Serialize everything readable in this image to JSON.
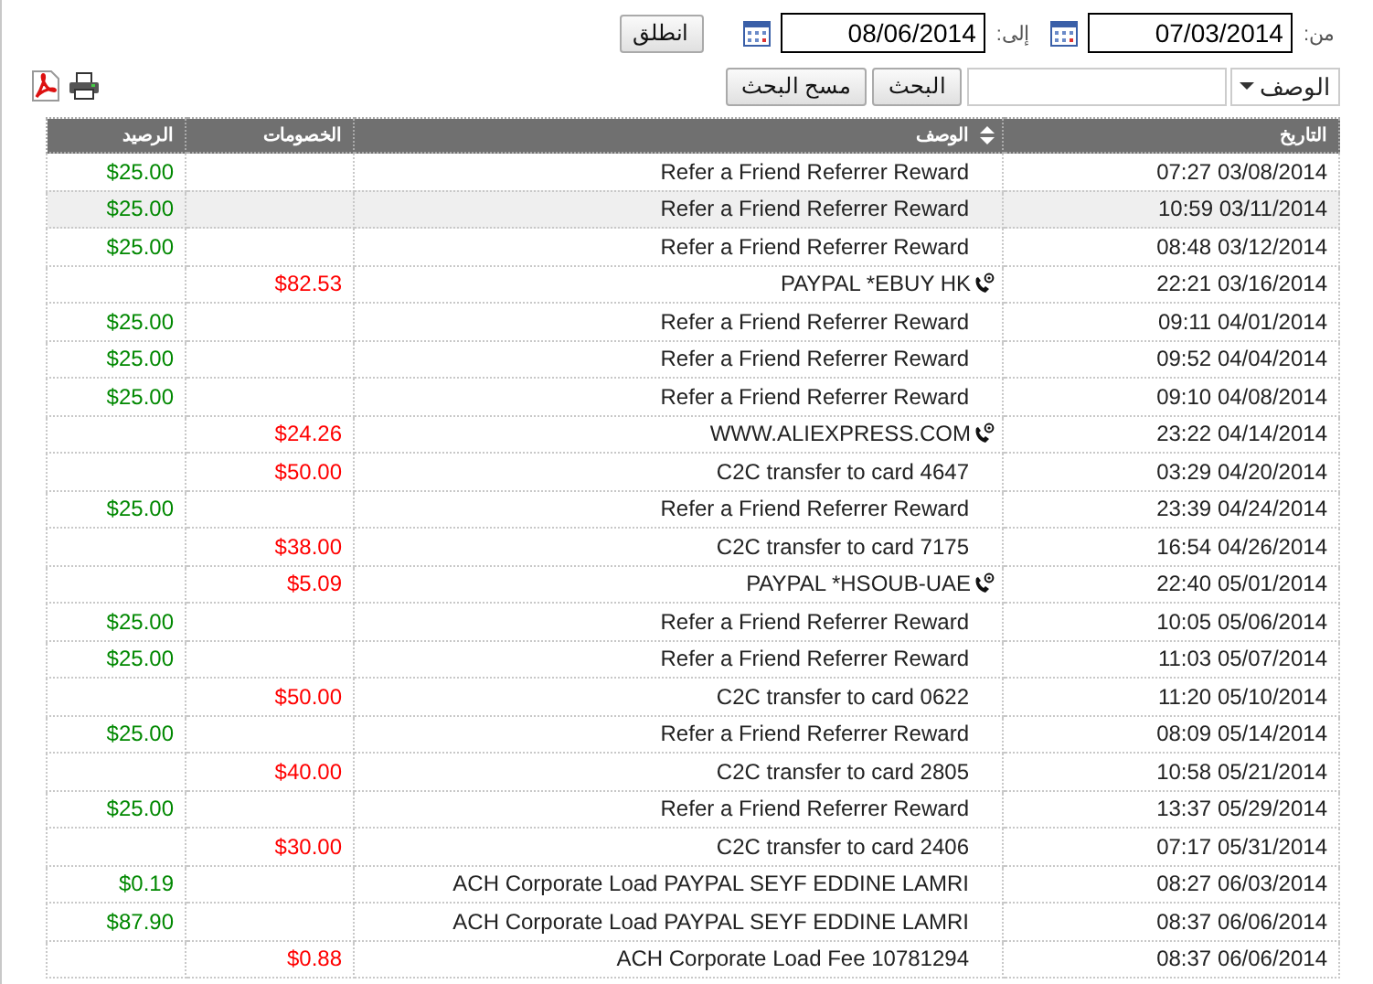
{
  "filters": {
    "from_label": "من:",
    "from_date": "07/03/2014",
    "to_label": "إلى:",
    "to_date": "08/06/2014",
    "go_button": "انطلق"
  },
  "search": {
    "field_select": "الوصف",
    "search_button": "البحث",
    "clear_button": "مسح البحث"
  },
  "table": {
    "columns": [
      "التاريخ",
      "الوصف",
      "الخصومات",
      "الرصيد"
    ],
    "rows": [
      {
        "date": "07:27 03/08/2014",
        "description": "Refer a Friend Referrer Reward",
        "deduction": "",
        "balance": "$25.00",
        "phone_order": false,
        "highlighted": false
      },
      {
        "date": "10:59 03/11/2014",
        "description": "Refer a Friend Referrer Reward",
        "deduction": "",
        "balance": "$25.00",
        "phone_order": false,
        "highlighted": true
      },
      {
        "date": "08:48 03/12/2014",
        "description": "Refer a Friend Referrer Reward",
        "deduction": "",
        "balance": "$25.00",
        "phone_order": false,
        "highlighted": false
      },
      {
        "date": "22:21 03/16/2014",
        "description": "PAYPAL *EBUY HK",
        "deduction": "$82.53",
        "balance": "",
        "phone_order": true,
        "highlighted": false
      },
      {
        "date": "09:11 04/01/2014",
        "description": "Refer a Friend Referrer Reward",
        "deduction": "",
        "balance": "$25.00",
        "phone_order": false,
        "highlighted": false
      },
      {
        "date": "09:52 04/04/2014",
        "description": "Refer a Friend Referrer Reward",
        "deduction": "",
        "balance": "$25.00",
        "phone_order": false,
        "highlighted": false
      },
      {
        "date": "09:10 04/08/2014",
        "description": "Refer a Friend Referrer Reward",
        "deduction": "",
        "balance": "$25.00",
        "phone_order": false,
        "highlighted": false
      },
      {
        "date": "23:22 04/14/2014",
        "description": "WWW.ALIEXPRESS.COM",
        "deduction": "$24.26",
        "balance": "",
        "phone_order": true,
        "highlighted": false
      },
      {
        "date": "03:29 04/20/2014",
        "description": "C2C transfer to card 4647",
        "deduction": "$50.00",
        "balance": "",
        "phone_order": false,
        "highlighted": false
      },
      {
        "date": "23:39 04/24/2014",
        "description": "Refer a Friend Referrer Reward",
        "deduction": "",
        "balance": "$25.00",
        "phone_order": false,
        "highlighted": false
      },
      {
        "date": "16:54 04/26/2014",
        "description": "C2C transfer to card 7175",
        "deduction": "$38.00",
        "balance": "",
        "phone_order": false,
        "highlighted": false
      },
      {
        "date": "22:40 05/01/2014",
        "description": "PAYPAL *HSOUB-UAE",
        "deduction": "$5.09",
        "balance": "",
        "phone_order": true,
        "highlighted": false
      },
      {
        "date": "10:05 05/06/2014",
        "description": "Refer a Friend Referrer Reward",
        "deduction": "",
        "balance": "$25.00",
        "phone_order": false,
        "highlighted": false
      },
      {
        "date": "11:03 05/07/2014",
        "description": "Refer a Friend Referrer Reward",
        "deduction": "",
        "balance": "$25.00",
        "phone_order": false,
        "highlighted": false
      },
      {
        "date": "11:20 05/10/2014",
        "description": "C2C transfer to card 0622",
        "deduction": "$50.00",
        "balance": "",
        "phone_order": false,
        "highlighted": false
      },
      {
        "date": "08:09 05/14/2014",
        "description": "Refer a Friend Referrer Reward",
        "deduction": "",
        "balance": "$25.00",
        "phone_order": false,
        "highlighted": false
      },
      {
        "date": "10:58 05/21/2014",
        "description": "C2C transfer to card 2805",
        "deduction": "$40.00",
        "balance": "",
        "phone_order": false,
        "highlighted": false
      },
      {
        "date": "13:37 05/29/2014",
        "description": "Refer a Friend Referrer Reward",
        "deduction": "",
        "balance": "$25.00",
        "phone_order": false,
        "highlighted": false
      },
      {
        "date": "07:17 05/31/2014",
        "description": "C2C transfer to card 2406",
        "deduction": "$30.00",
        "balance": "",
        "phone_order": false,
        "highlighted": false
      },
      {
        "date": "08:27 06/03/2014",
        "description": "ACH Corporate Load PAYPAL SEYF EDDINE LAMRI",
        "deduction": "",
        "balance": "$0.19",
        "phone_order": false,
        "highlighted": false
      },
      {
        "date": "08:37 06/06/2014",
        "description": "ACH Corporate Load PAYPAL SEYF EDDINE LAMRI",
        "deduction": "",
        "balance": "$87.90",
        "phone_order": false,
        "highlighted": false
      },
      {
        "date": "08:37 06/06/2014",
        "description": "ACH Corporate Load Fee 10781294",
        "deduction": "$0.88",
        "balance": "",
        "phone_order": false,
        "highlighted": false
      }
    ]
  }
}
